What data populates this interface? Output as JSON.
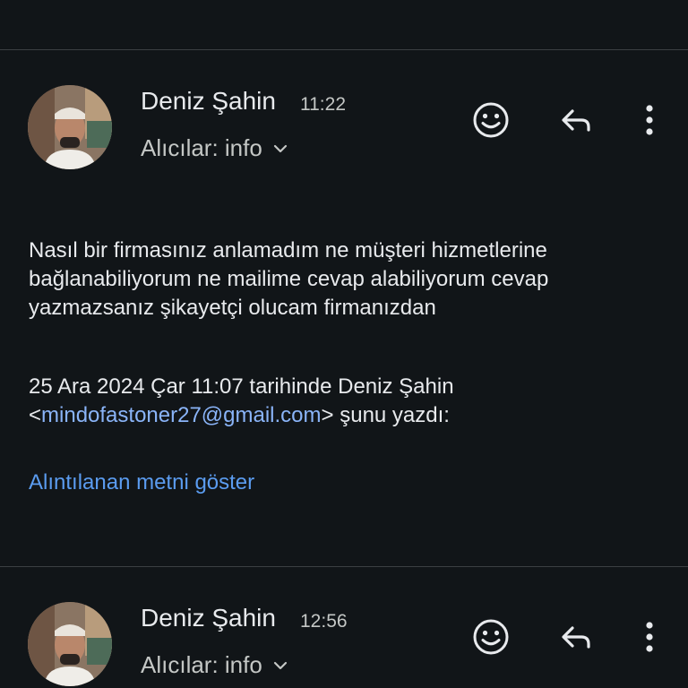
{
  "messages": [
    {
      "sender": "Deniz Şahin",
      "time": "11:22",
      "recipients": "Alıcılar: info"
    },
    {
      "sender": "Deniz Şahin",
      "time": "12:56",
      "recipients": "Alıcılar: info"
    }
  ],
  "body": {
    "line1": "Nasıl bir firmasınız anlamadım ne müşteri hizmetlerine",
    "line2": "bağlanabiliyorum ne mailime cevap alabiliyorum cevap",
    "line3": "yazmazsanız şikayetçi olucam firmanızdan"
  },
  "quote_header": {
    "line1": "25 Ara 2024 Çar 11:07 tarihinde Deniz Şahin",
    "open": "<",
    "email": "mindofastoner27@gmail.com",
    "close": "> şunu yazdı:"
  },
  "show_quoted_label": "Alıntılanan metni göster",
  "icons": [
    "emoji-reaction-icon",
    "reply-icon",
    "more-vert-icon",
    "chevron-down-icon"
  ],
  "colors": {
    "background": "#111518",
    "link": "#8ab4f8",
    "divider": "#3c4043"
  }
}
